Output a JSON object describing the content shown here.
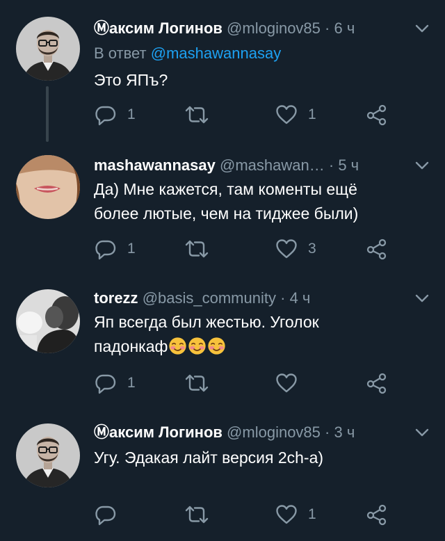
{
  "tweets": [
    {
      "name": "Ⓜаксим Логинов",
      "handle": "@mloginov85",
      "dot": "·",
      "time": "6 ч",
      "reply_prefix": "В ответ",
      "reply_to": "@mashawannasay",
      "text": "Это ЯПъ?",
      "reply_count": "1",
      "retweet_count": "",
      "like_count": "1"
    },
    {
      "name": "mashawannasay",
      "handle": "@mashawan…",
      "dot": "·",
      "time": "5 ч",
      "text_line1": "Да) Мне кажется, там коменты ещё",
      "text_line2": "более лютые, чем на тиджее были)",
      "reply_count": "1",
      "retweet_count": "",
      "like_count": "3"
    },
    {
      "name": "torezz",
      "handle": "@basis_community",
      "dot": "·",
      "time": "4 ч",
      "text_line1": "Яп всегда был жестью. Уголок",
      "text_line2": "падонкаф",
      "emoji": "smiling-blushing-face-emoji",
      "reply_count": "1",
      "retweet_count": "",
      "like_count": ""
    },
    {
      "name": "Ⓜаксим Логинов",
      "handle": "@mloginov85",
      "dot": "·",
      "time": "3 ч",
      "text": "Угу. Эдакая лайт версия 2ch-a)",
      "reply_count": "",
      "retweet_count": "",
      "like_count": "1"
    }
  ],
  "colors": {
    "background": "#15202b",
    "secondary_text": "#8899a6",
    "link": "#1da1f2",
    "thread_line": "#38444d"
  }
}
